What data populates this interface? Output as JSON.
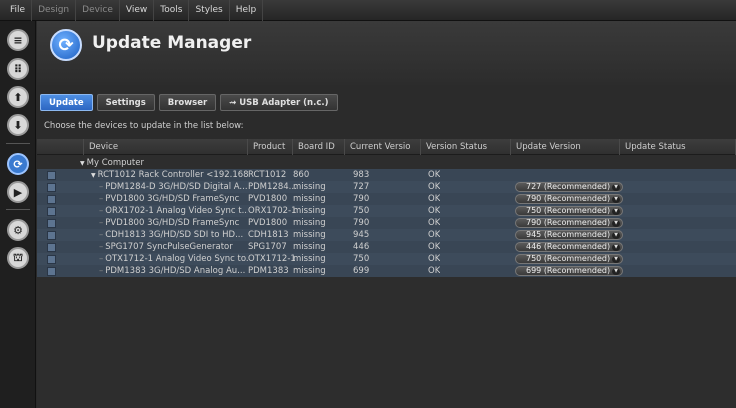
{
  "menu": [
    {
      "label": "File",
      "dim": false
    },
    {
      "label": "Design",
      "dim": true
    },
    {
      "label": "Device",
      "dim": true
    },
    {
      "label": "View",
      "dim": false
    },
    {
      "label": "Tools",
      "dim": false
    },
    {
      "label": "Styles",
      "dim": false
    },
    {
      "label": "Help",
      "dim": false
    }
  ],
  "sidebar_icons": [
    "sliders-icon",
    "grid-icon",
    "upload-icon",
    "download-icon",
    "update-icon",
    "play-icon",
    "settings-icon",
    "network-icon"
  ],
  "header": {
    "title": "Update Manager"
  },
  "tabs": [
    {
      "label": "Update",
      "active": true
    },
    {
      "label": "Settings",
      "active": false
    },
    {
      "label": "Browser",
      "active": false
    },
    {
      "label": "USB Adapter (n.c.)",
      "active": false
    }
  ],
  "usb_icon_glyph": "⇝",
  "subtitle": "Choose the devices to update in the list below:",
  "columns": [
    "Device",
    "Product",
    "Board ID",
    "Current Versio",
    "Version Status",
    "Update Version",
    "Update Status"
  ],
  "root": {
    "label": "My Computer"
  },
  "controller": {
    "device": "RCT1012 Rack Controller <192.168...",
    "product": "RCT1012",
    "board": "860",
    "current": "983",
    "status": "OK"
  },
  "rows": [
    {
      "device": "PDM1284-D 3G/HD/SD Digital A...",
      "product": "PDM1284...",
      "board": "missing",
      "current": "727",
      "status": "OK",
      "update": "727 (Recommended)"
    },
    {
      "device": "PVD1800 3G/HD/SD FrameSync",
      "product": "PVD1800",
      "board": "missing",
      "current": "790",
      "status": "OK",
      "update": "790 (Recommended)"
    },
    {
      "device": "ORX1702-1 Analog Video Sync t...",
      "product": "ORX1702-1",
      "board": "missing",
      "current": "750",
      "status": "OK",
      "update": "750 (Recommended)"
    },
    {
      "device": "PVD1800 3G/HD/SD FrameSync",
      "product": "PVD1800",
      "board": "missing",
      "current": "790",
      "status": "OK",
      "update": "790 (Recommended)"
    },
    {
      "device": "CDH1813 3G/HD/SD SDI to HD...",
      "product": "CDH1813",
      "board": "missing",
      "current": "945",
      "status": "OK",
      "update": "945 (Recommended)"
    },
    {
      "device": "SPG1707 SyncPulseGenerator",
      "product": "SPG1707",
      "board": "missing",
      "current": "446",
      "status": "OK",
      "update": "446 (Recommended)"
    },
    {
      "device": "OTX1712-1 Analog Video Sync to...",
      "product": "OTX1712-1",
      "board": "missing",
      "current": "750",
      "status": "OK",
      "update": "750 (Recommended)"
    },
    {
      "device": "PDM1383 3G/HD/SD Analog Au...",
      "product": "PDM1383",
      "board": "missing",
      "current": "699",
      "status": "OK",
      "update": "699 (Recommended)"
    }
  ]
}
